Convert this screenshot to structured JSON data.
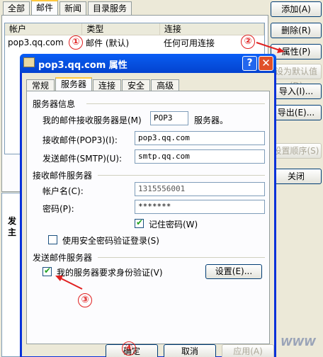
{
  "accounts": {
    "tabs": [
      "全部",
      "邮件",
      "新闻",
      "目录服务"
    ],
    "columns": [
      "帐户",
      "类型",
      "连接"
    ],
    "row": {
      "account": "pop3.qq.com",
      "type": "邮件 (默认)",
      "connection": "任何可用连接"
    },
    "side_buttons": {
      "add": "添加(A)",
      "remove": "删除(R)",
      "properties": "属性(P)",
      "set_default": "设为默认值(D)",
      "import": "导入(I)...",
      "export": "导出(E)...",
      "set_order": "设置顺序(S)"
    },
    "close": "关闭",
    "lower_labels": [
      "发",
      "主"
    ]
  },
  "dialog": {
    "title": "pop3.qq.com 属性",
    "help": "?",
    "close": "✕",
    "tabs": [
      "常规",
      "服务器",
      "连接",
      "安全",
      "高级"
    ],
    "active_tab": "服务器",
    "server_info": {
      "heading": "服务器信息",
      "incoming_type_label": "我的邮件接收服务器是(M)",
      "incoming_type": "POP3",
      "incoming_type_suffix": "服务器。",
      "pop3_label": "接收邮件(POP3)(I):",
      "pop3_value": "pop3.qq.com",
      "smtp_label": "发送邮件(SMTP)(U):",
      "smtp_value": "smtp.qq.com"
    },
    "incoming": {
      "heading": "接收邮件服务器",
      "account_label": "帐户名(C):",
      "account_value": "1315556001",
      "password_label": "密码(P):",
      "password_value": "*******",
      "remember_label": "记住密码(W)",
      "spa_label": "使用安全密码验证登录(S)"
    },
    "outgoing": {
      "heading": "发送邮件服务器",
      "auth_label": "我的服务器要求身份验证(V)",
      "settings_button": "设置(E)..."
    },
    "buttons": {
      "ok": "确定",
      "cancel": "取消",
      "apply": "应用(A)"
    }
  },
  "annotations": [
    "①",
    "②",
    "③",
    "④"
  ],
  "annotation_color": "#e02020",
  "watermark": "WWW"
}
